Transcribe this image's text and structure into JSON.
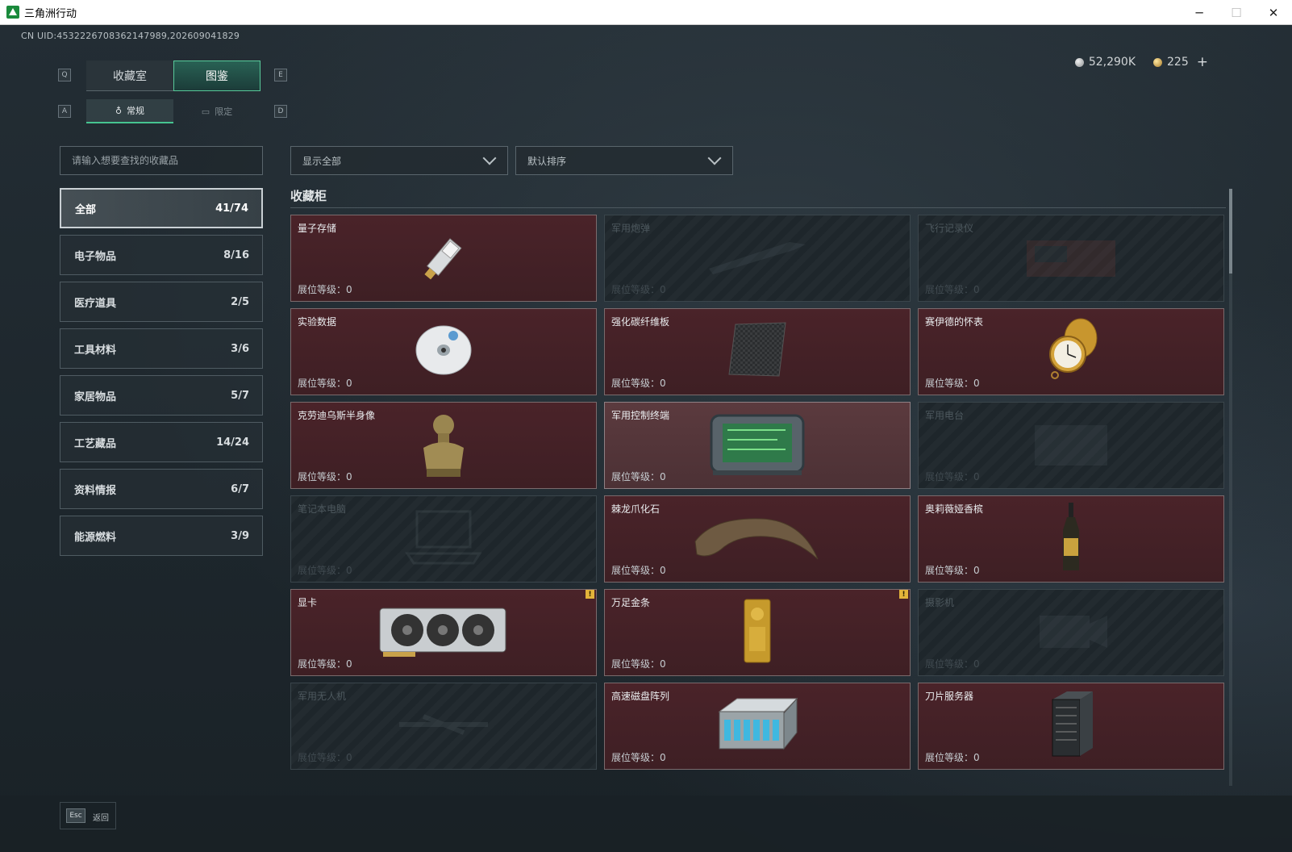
{
  "window": {
    "title": "三角洲行动",
    "minimize": "─",
    "maximize": "☐",
    "close": "✕"
  },
  "uid": "CN UID:4532226708362147989,202609041829",
  "currency": [
    {
      "icon": "silver-coin-icon",
      "value": "52,290K"
    },
    {
      "icon": "gold-coin-icon",
      "value": "225"
    }
  ],
  "currency_plus": "+",
  "hotkeys": {
    "prev_tab": "Q",
    "next_tab": "E",
    "prev_sub": "A",
    "next_sub": "D"
  },
  "main_tabs": [
    {
      "label": "收藏室",
      "active": false
    },
    {
      "label": "图鉴",
      "active": true
    }
  ],
  "sub_tabs": [
    {
      "label": "常规",
      "icon": "bottle-icon",
      "active": true
    },
    {
      "label": "限定",
      "icon": "frame-icon",
      "active": false
    }
  ],
  "search": {
    "placeholder": "请输入想要查找的收藏品"
  },
  "categories": [
    {
      "label": "全部",
      "count": "41/74",
      "active": true
    },
    {
      "label": "电子物品",
      "count": "8/16"
    },
    {
      "label": "医疗道具",
      "count": "2/5"
    },
    {
      "label": "工具材料",
      "count": "3/6"
    },
    {
      "label": "家居物品",
      "count": "5/7"
    },
    {
      "label": "工艺藏品",
      "count": "14/24"
    },
    {
      "label": "资料情报",
      "count": "6/7"
    },
    {
      "label": "能源燃料",
      "count": "3/9"
    }
  ],
  "filter": {
    "selected": "显示全部"
  },
  "sort": {
    "selected": "默认排序"
  },
  "section_title": "收藏柜",
  "level_label": "展位等级：0",
  "items": [
    {
      "name": "量子存储",
      "owned": true,
      "art": "usb-drive-icon"
    },
    {
      "name": "军用炮弹",
      "owned": false,
      "art": "shell-icon"
    },
    {
      "name": "飞行记录仪",
      "owned": false,
      "art": "recorder-icon"
    },
    {
      "name": "实验数据",
      "owned": true,
      "art": "disc-icon"
    },
    {
      "name": "强化碳纤维板",
      "owned": true,
      "art": "carbon-plate-icon"
    },
    {
      "name": "赛伊德的怀表",
      "owned": true,
      "art": "pocket-watch-icon"
    },
    {
      "name": "克劳迪乌斯半身像",
      "owned": true,
      "art": "bust-icon"
    },
    {
      "name": "军用控制终端",
      "owned": true,
      "highlight": true,
      "art": "terminal-icon"
    },
    {
      "name": "军用电台",
      "owned": false,
      "art": "radio-icon"
    },
    {
      "name": "笔记本电脑",
      "owned": false,
      "art": "laptop-icon"
    },
    {
      "name": "棘龙爪化石",
      "owned": true,
      "art": "claw-fossil-icon"
    },
    {
      "name": "奥莉薇娅香槟",
      "owned": true,
      "art": "champagne-icon"
    },
    {
      "name": "显卡",
      "owned": true,
      "badge": "!",
      "art": "gpu-icon"
    },
    {
      "name": "万足金条",
      "owned": true,
      "badge": "!",
      "art": "gold-bar-icon"
    },
    {
      "name": "摄影机",
      "owned": false,
      "art": "camera-icon"
    },
    {
      "name": "军用无人机",
      "owned": false,
      "art": "drone-icon"
    },
    {
      "name": "高速磁盘阵列",
      "owned": true,
      "art": "disk-array-icon"
    },
    {
      "name": "刀片服务器",
      "owned": true,
      "art": "blade-server-icon"
    }
  ],
  "footer": {
    "esc": "Esc",
    "back": "返回"
  }
}
